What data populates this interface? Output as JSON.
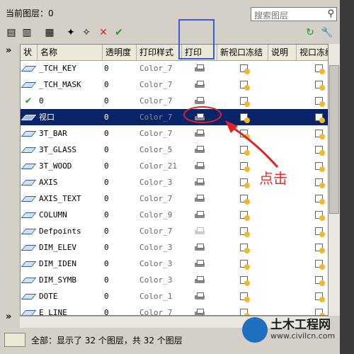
{
  "panel": {
    "current_layer_label": "当前图层：0",
    "search_placeholder": "搜索图层"
  },
  "toolbar": {
    "icons": [
      "new-property-filter-icon",
      "new-group-filter-icon",
      "layer-states-icon",
      "new-layer-icon",
      "new-layer-vp-frozen-icon",
      "delete-layer-icon",
      "set-current-icon",
      "refresh-icon",
      "settings-icon"
    ]
  },
  "table": {
    "columns": [
      "状",
      "名称",
      "透明度",
      "打印样式",
      "打印",
      "新视口冻结",
      "说明",
      "视口冻结"
    ],
    "rows": [
      {
        "status": "layer",
        "name": "_TCH_KEY",
        "transparency": "0",
        "plot_style": "Color_7",
        "print": "on"
      },
      {
        "status": "layer",
        "name": "_TCH_MASK",
        "transparency": "0",
        "plot_style": "Color_7",
        "print": "on"
      },
      {
        "status": "current",
        "name": "0",
        "transparency": "0",
        "plot_style": "Color_7",
        "print": "on"
      },
      {
        "status": "layer",
        "name": "视口",
        "transparency": "0",
        "plot_style": "Color_7",
        "print": "on",
        "selected": true
      },
      {
        "status": "layer",
        "name": "3T_BAR",
        "transparency": "0",
        "plot_style": "Color_7",
        "print": "on"
      },
      {
        "status": "layer",
        "name": "3T_GLASS",
        "transparency": "0",
        "plot_style": "Color_5",
        "print": "on"
      },
      {
        "status": "layer",
        "name": "3T_WOOD",
        "transparency": "0",
        "plot_style": "Color_21",
        "print": "on"
      },
      {
        "status": "layer",
        "name": "AXIS",
        "transparency": "0",
        "plot_style": "Color_3",
        "print": "on"
      },
      {
        "status": "layer",
        "name": "AXIS_TEXT",
        "transparency": "0",
        "plot_style": "Color_7",
        "print": "on"
      },
      {
        "status": "layer",
        "name": "COLUMN",
        "transparency": "0",
        "plot_style": "Color_9",
        "print": "on"
      },
      {
        "status": "layer",
        "name": "Defpoints",
        "transparency": "0",
        "plot_style": "Color_7",
        "print": "off"
      },
      {
        "status": "layer",
        "name": "DIM_ELEV",
        "transparency": "0",
        "plot_style": "Color_3",
        "print": "on"
      },
      {
        "status": "layer",
        "name": "DIM_IDEN",
        "transparency": "0",
        "plot_style": "Color_3",
        "print": "on"
      },
      {
        "status": "layer",
        "name": "DIM_SYMB",
        "transparency": "0",
        "plot_style": "Color_3",
        "print": "on"
      },
      {
        "status": "layer",
        "name": "DOTE",
        "transparency": "0",
        "plot_style": "Color_1",
        "print": "on"
      },
      {
        "status": "layer",
        "name": "E_LINE",
        "transparency": "0",
        "plot_style": "Color_7",
        "print": "on"
      }
    ]
  },
  "status_bar": {
    "text": "全部：显示了 32 个图层，共 32 个图层"
  },
  "annotation": {
    "text": "点击"
  },
  "watermark": {
    "brand": "土木工程网",
    "url": "www.civilcn.com"
  },
  "colors": {
    "selection": "#0a246a",
    "annotation_red": "#e02222",
    "highlight_blue": "#3a5ed8"
  }
}
